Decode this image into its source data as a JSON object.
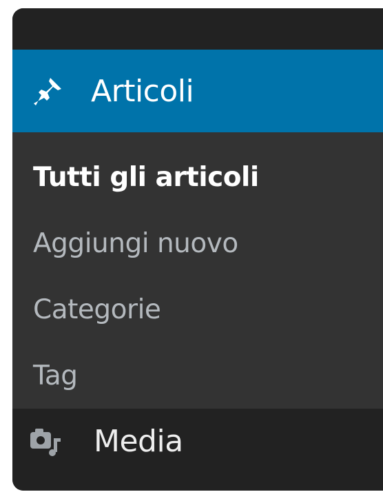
{
  "colors": {
    "active_bg": "#0073aa",
    "menu_bg": "#222222",
    "submenu_bg": "#333333",
    "submenu_text": "#b4b9be",
    "current_text": "#ffffff",
    "arrow": "#f1f1f1"
  },
  "menu": {
    "articoli": {
      "label": "Articoli",
      "icon": "pushpin-icon"
    },
    "submenu": [
      {
        "label": "Tutti gli articoli",
        "current": true
      },
      {
        "label": "Aggiungi nuovo",
        "current": false
      },
      {
        "label": "Categorie",
        "current": false
      },
      {
        "label": "Tag",
        "current": false
      }
    ],
    "media": {
      "label": "Media",
      "icon": "media-icon"
    }
  }
}
